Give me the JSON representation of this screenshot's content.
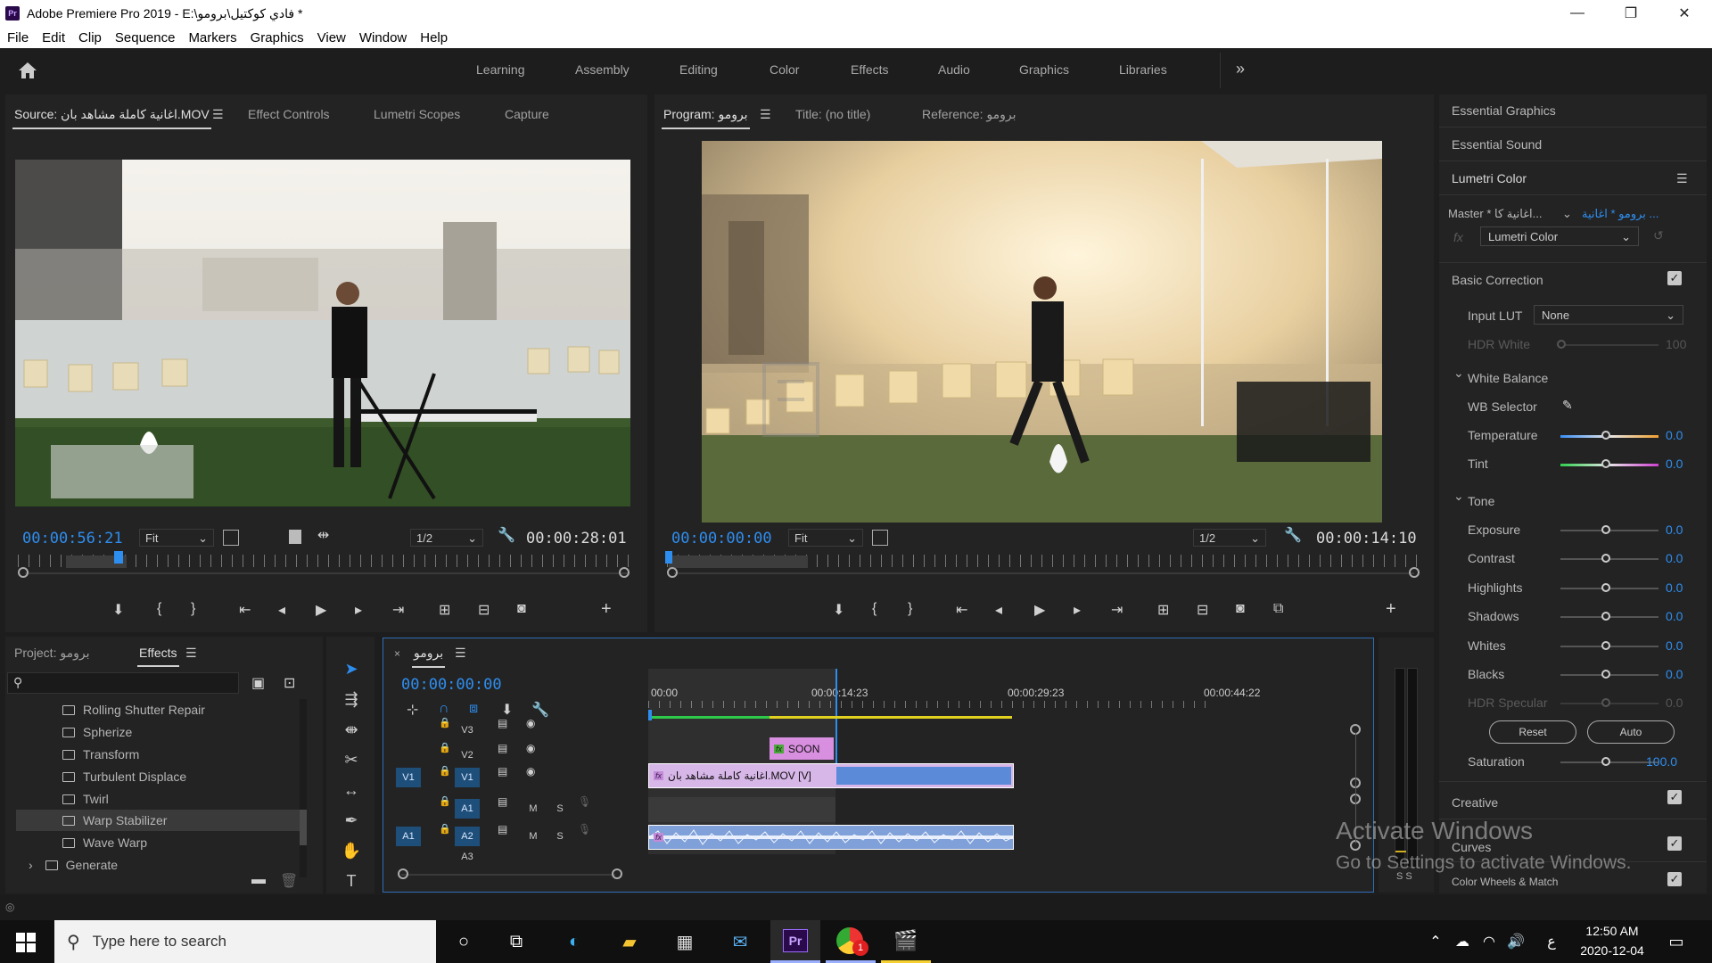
{
  "window": {
    "title": "Adobe Premiere Pro 2019 - E:\\فادي كوكتيل\\برومو *",
    "app_icon_label": "Pr",
    "controls": {
      "minimize": "—",
      "maximize": "❐",
      "close": "✕"
    }
  },
  "menu": [
    "File",
    "Edit",
    "Clip",
    "Sequence",
    "Markers",
    "Graphics",
    "View",
    "Window",
    "Help"
  ],
  "workspaces": [
    "Learning",
    "Assembly",
    "Editing",
    "Color",
    "Effects",
    "Audio",
    "Graphics",
    "Libraries"
  ],
  "source_panel": {
    "tabs": [
      "Source: اغانية كاملة مشاهد بان.MOV",
      "Effect Controls",
      "Lumetri Scopes",
      "Capture"
    ],
    "timecode": "00:00:56:21",
    "fit": "Fit",
    "resolution": "1/2",
    "duration": "00:00:28:01"
  },
  "program_panel": {
    "tabs": [
      "Program: برومو",
      "Title: (no title)",
      "Reference: برومو"
    ],
    "timecode": "00:00:00:00",
    "fit": "Fit",
    "resolution": "1/2",
    "duration": "00:00:14:10"
  },
  "project_panel": {
    "tabs": [
      "Project: برومو",
      "Effects"
    ],
    "effects": [
      "Rolling Shutter Repair",
      "Spherize",
      "Transform",
      "Turbulent Displace",
      "Twirl",
      "Warp Stabilizer",
      "Wave Warp"
    ],
    "selected_effect": "Warp Stabilizer",
    "folder": "Generate"
  },
  "timeline": {
    "sequence": "برومو",
    "timecode": "00:00:00:00",
    "ruler": [
      "00:00",
      "00:00:14:23",
      "00:00:29:23",
      "00:00:44:22"
    ],
    "tracks": {
      "v3": "V3",
      "v2": "V2",
      "v1_src": "V1",
      "v1": "V1",
      "a1": "A1",
      "a1_src": "A1",
      "a2": "A2",
      "a3": "A3",
      "mute": "M",
      "solo": "S"
    },
    "clips": {
      "soon": "SOON",
      "video": "اغانية كاملة مشاهد بان.MOV [V]"
    },
    "fx_badge": "fx"
  },
  "right_panel": {
    "collapsed": [
      "Essential Graphics",
      "Essential Sound"
    ],
    "lumetri_title": "Lumetri Color",
    "master": "Master * اغانية كا...",
    "master_target": "برومو * اغانية ...",
    "effect": "Lumetri Color",
    "basic_correction": "Basic Correction",
    "input_lut_label": "Input LUT",
    "input_lut_value": "None",
    "hdr_white_label": "HDR White",
    "hdr_white_value": "100",
    "white_balance": "White Balance",
    "wb_selector": "WB Selector",
    "temperature": {
      "label": "Temperature",
      "value": "0.0"
    },
    "tint": {
      "label": "Tint",
      "value": "0.0"
    },
    "tone": "Tone",
    "tone_rows": [
      {
        "label": "Exposure",
        "value": "0.0"
      },
      {
        "label": "Contrast",
        "value": "0.0"
      },
      {
        "label": "Highlights",
        "value": "0.0"
      },
      {
        "label": "Shadows",
        "value": "0.0"
      },
      {
        "label": "Whites",
        "value": "0.0"
      },
      {
        "label": "Blacks",
        "value": "0.0"
      }
    ],
    "hdr_specular": {
      "label": "HDR Specular",
      "value": "0.0"
    },
    "reset": "Reset",
    "auto": "Auto",
    "saturation": {
      "label": "Saturation",
      "value": "100.0"
    },
    "creative": "Creative",
    "curves": "Curves",
    "color_wheels": "Color Wheels & Match"
  },
  "activate_windows": {
    "title": "Activate Windows",
    "subtitle": "Go to Settings to activate Windows."
  },
  "taskbar": {
    "search_placeholder": "Type here to search",
    "badge": "1",
    "lang": "ع",
    "time": "12:50 AM",
    "date": "2020-12-04"
  },
  "meter_label": "S S"
}
